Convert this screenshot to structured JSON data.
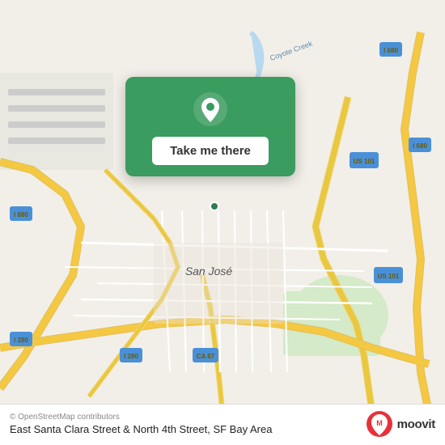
{
  "map": {
    "attribution": "© OpenStreetMap contributors",
    "location_name": "East Santa Clara Street & North 4th Street, SF Bay Area"
  },
  "action_card": {
    "button_label": "Take me there"
  },
  "moovit": {
    "logo_text": "moovit"
  }
}
